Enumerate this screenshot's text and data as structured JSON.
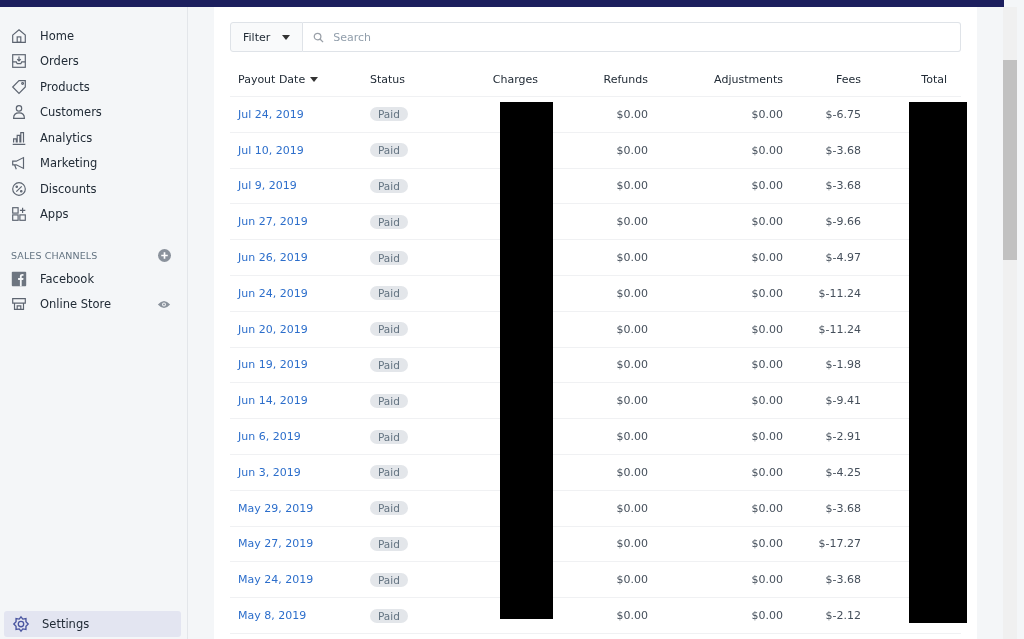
{
  "sidebar": {
    "items": [
      {
        "label": "Home"
      },
      {
        "label": "Orders"
      },
      {
        "label": "Products"
      },
      {
        "label": "Customers"
      },
      {
        "label": "Analytics"
      },
      {
        "label": "Marketing"
      },
      {
        "label": "Discounts"
      },
      {
        "label": "Apps"
      }
    ],
    "section_title": "SALES CHANNELS",
    "channels": [
      {
        "label": "Facebook"
      },
      {
        "label": "Online Store"
      }
    ],
    "settings": {
      "label": "Settings",
      "selected": true
    }
  },
  "filter": {
    "label": "Filter",
    "search_placeholder": "Search"
  },
  "table": {
    "columns": [
      "Payout Date",
      "Status",
      "Charges",
      "Refunds",
      "Adjustments",
      "Fees",
      "Total"
    ],
    "rows": [
      {
        "date": "Jul 24, 2019",
        "status": "Paid",
        "refunds": "$0.00",
        "adjustments": "$0.00",
        "fees": "$-6.75"
      },
      {
        "date": "Jul 10, 2019",
        "status": "Paid",
        "refunds": "$0.00",
        "adjustments": "$0.00",
        "fees": "$-3.68"
      },
      {
        "date": "Jul 9, 2019",
        "status": "Paid",
        "refunds": "$0.00",
        "adjustments": "$0.00",
        "fees": "$-3.68"
      },
      {
        "date": "Jun 27, 2019",
        "status": "Paid",
        "refunds": "$0.00",
        "adjustments": "$0.00",
        "fees": "$-9.66"
      },
      {
        "date": "Jun 26, 2019",
        "status": "Paid",
        "refunds": "$0.00",
        "adjustments": "$0.00",
        "fees": "$-4.97"
      },
      {
        "date": "Jun 24, 2019",
        "status": "Paid",
        "refunds": "$0.00",
        "adjustments": "$0.00",
        "fees": "$-11.24"
      },
      {
        "date": "Jun 20, 2019",
        "status": "Paid",
        "refunds": "$0.00",
        "adjustments": "$0.00",
        "fees": "$-11.24"
      },
      {
        "date": "Jun 19, 2019",
        "status": "Paid",
        "refunds": "$0.00",
        "adjustments": "$0.00",
        "fees": "$-1.98"
      },
      {
        "date": "Jun 14, 2019",
        "status": "Paid",
        "refunds": "$0.00",
        "adjustments": "$0.00",
        "fees": "$-9.41"
      },
      {
        "date": "Jun 6, 2019",
        "status": "Paid",
        "refunds": "$0.00",
        "adjustments": "$0.00",
        "fees": "$-2.91"
      },
      {
        "date": "Jun 3, 2019",
        "status": "Paid",
        "refunds": "$0.00",
        "adjustments": "$0.00",
        "fees": "$-4.25"
      },
      {
        "date": "May 29, 2019",
        "status": "Paid",
        "refunds": "$0.00",
        "adjustments": "$0.00",
        "fees": "$-3.68"
      },
      {
        "date": "May 27, 2019",
        "status": "Paid",
        "refunds": "$0.00",
        "adjustments": "$0.00",
        "fees": "$-17.27"
      },
      {
        "date": "May 24, 2019",
        "status": "Paid",
        "refunds": "$0.00",
        "adjustments": "$0.00",
        "fees": "$-3.68"
      },
      {
        "date": "May 8, 2019",
        "status": "Paid",
        "refunds": "$0.00",
        "adjustments": "$0.00",
        "fees": "$-2.12"
      }
    ]
  }
}
